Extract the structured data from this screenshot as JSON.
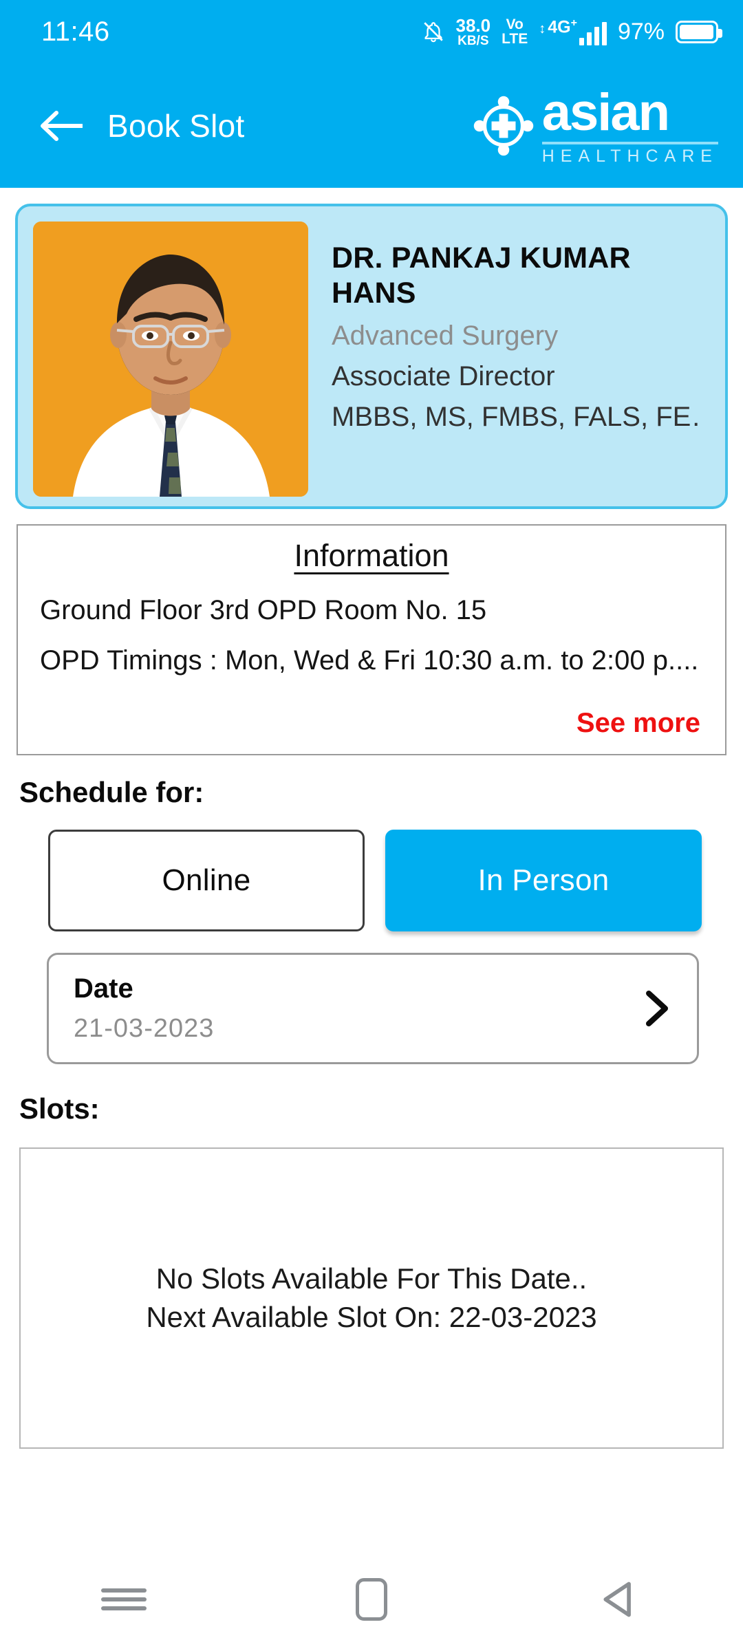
{
  "status_bar": {
    "time": "11:46",
    "notification_icon": "bell-muted-icon",
    "net_speed_value": "38.0",
    "net_speed_unit": "KB/S",
    "volte_line1": "Vo",
    "volte_line2": "LTE",
    "network_type": "4G",
    "network_superscript": "+",
    "battery_percent": "97%",
    "battery_icon": "battery-full-icon"
  },
  "header": {
    "back_icon": "back-arrow-icon",
    "title": "Book Slot",
    "brand_emblem": "medical-cross-emblem-icon",
    "brand_name": "asian",
    "brand_subtitle": "HEALTHCARE"
  },
  "doctor": {
    "photo_alt": "doctor-portrait",
    "name": "DR. PANKAJ KUMAR HANS",
    "department": "Advanced Surgery",
    "designation": "Associate Director",
    "qualifications": "MBBS, MS, FMBS, FALS, FE…"
  },
  "information": {
    "title": "Information",
    "line1": "Ground Floor 3rd OPD Room No. 15",
    "line2": "OPD Timings : Mon, Wed & Fri 10:30 a.m. to 2:00 p....",
    "see_more_label": "See more"
  },
  "schedule": {
    "label": "Schedule for:",
    "option_online": "Online",
    "option_in_person": "In Person",
    "selected": "In Person"
  },
  "date_field": {
    "label": "Date",
    "value": "21-03-2023",
    "chevron_icon": "chevron-right-icon"
  },
  "slots": {
    "label": "Slots:",
    "empty_line1": "No Slots Available For This Date..",
    "empty_line2": "Next Available Slot On: 22-03-2023"
  },
  "nav_bar": {
    "recents_icon": "recents-icon",
    "home_icon": "home-icon",
    "back_icon": "back-triangle-icon"
  },
  "colors": {
    "brand_blue": "#00AEEF",
    "card_bg": "#BDE8F7",
    "card_border": "#45C1EA",
    "photo_bg": "#F09E20",
    "alert_red": "#EE1111",
    "muted_gray": "#8d8d8d"
  }
}
